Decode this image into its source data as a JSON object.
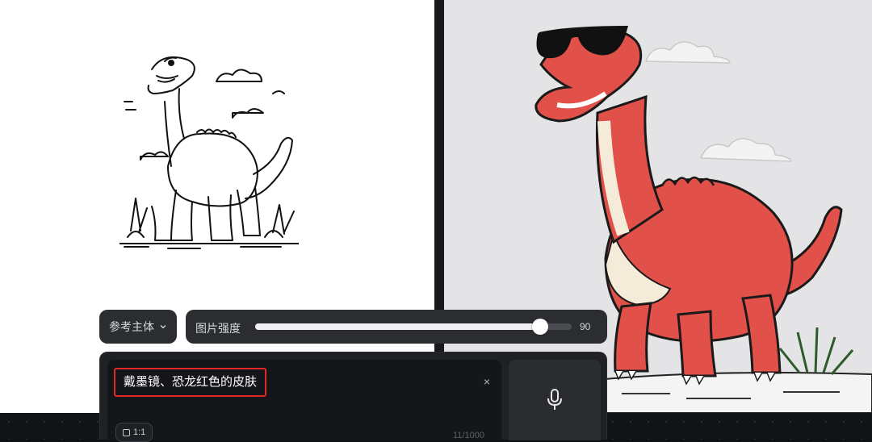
{
  "controls": {
    "subject_label": "参考主体",
    "strength_label": "图片强度",
    "strength_value": "90",
    "strength_fraction": 0.9
  },
  "prompt": {
    "text": "戴墨镜、恐龙红色的皮肤",
    "clear_symbol": "×",
    "ratio_label": "1:1",
    "char_count": "11/1000"
  },
  "icons": {
    "dropdown": "chevron-down-icon",
    "clear": "close-icon",
    "voice": "microphone-icon",
    "ratio": "square-icon"
  },
  "colors": {
    "highlight_border": "#e32828",
    "dino_red": "#e2504a",
    "panel_dark": "#1f2124"
  }
}
